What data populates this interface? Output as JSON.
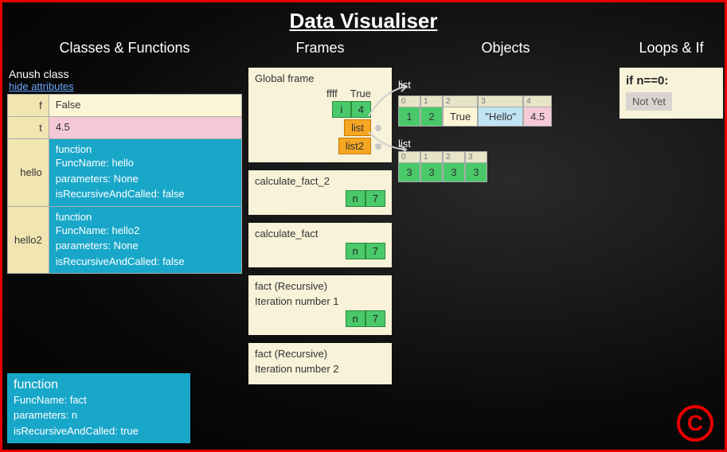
{
  "title": "Data Visualiser",
  "headers": {
    "classes": "Classes & Functions",
    "frames": "Frames",
    "objects": "Objects",
    "loops": "Loops & If"
  },
  "class_panel": {
    "class_name": "Anush class",
    "hide_link": "hide attributes",
    "rows": {
      "r0": {
        "key": "f",
        "val": "False"
      },
      "r1": {
        "key": "t",
        "val": "4.5"
      },
      "r2": {
        "key": "hello",
        "fn_label": "function",
        "l1": "FuncName: hello",
        "l2": "parameters: None",
        "l3": "isRecursiveAndCalled: false"
      },
      "r3": {
        "key": "hello2",
        "fn_label": "function",
        "l1": "FuncName: hello2",
        "l2": "parameters: None",
        "l3": "isRecursiveAndCalled: false"
      }
    },
    "standalone_fn": {
      "fn_label": "function",
      "l1": "FuncName: fact",
      "l2": "parameters: n",
      "l3": "isRecursiveAndCalled: true"
    }
  },
  "frames": {
    "f0": {
      "title": "Global frame",
      "head_l": "ffff",
      "head_r": "True",
      "i_k": "i",
      "i_v": "4",
      "list_k": "list",
      "list2_k": "list2"
    },
    "f1": {
      "title": "calculate_fact_2",
      "k": "n",
      "v": "7"
    },
    "f2": {
      "title": "calculate_fact",
      "k": "n",
      "v": "7"
    },
    "f3": {
      "title": "fact (Recursive)",
      "sub": "Iteration number 1",
      "k": "n",
      "v": "7"
    },
    "f4": {
      "title": "fact (Recursive)",
      "sub": "Iteration number 2"
    }
  },
  "objects": {
    "label1": "list",
    "list1": {
      "i0": "0",
      "i1": "1",
      "i2": "2",
      "i3": "3",
      "i4": "4",
      "v0": "1",
      "v1": "2",
      "v2": "True",
      "v3": "\"Hello\"",
      "v4": "4.5"
    },
    "label2": "list",
    "list2": {
      "i0": "0",
      "i1": "1",
      "i2": "2",
      "i3": "3",
      "v0": "3",
      "v1": "3",
      "v2": "3",
      "v3": "3"
    }
  },
  "loops": {
    "cond": "if n==0:",
    "status": "Not Yet"
  },
  "badge": "C"
}
